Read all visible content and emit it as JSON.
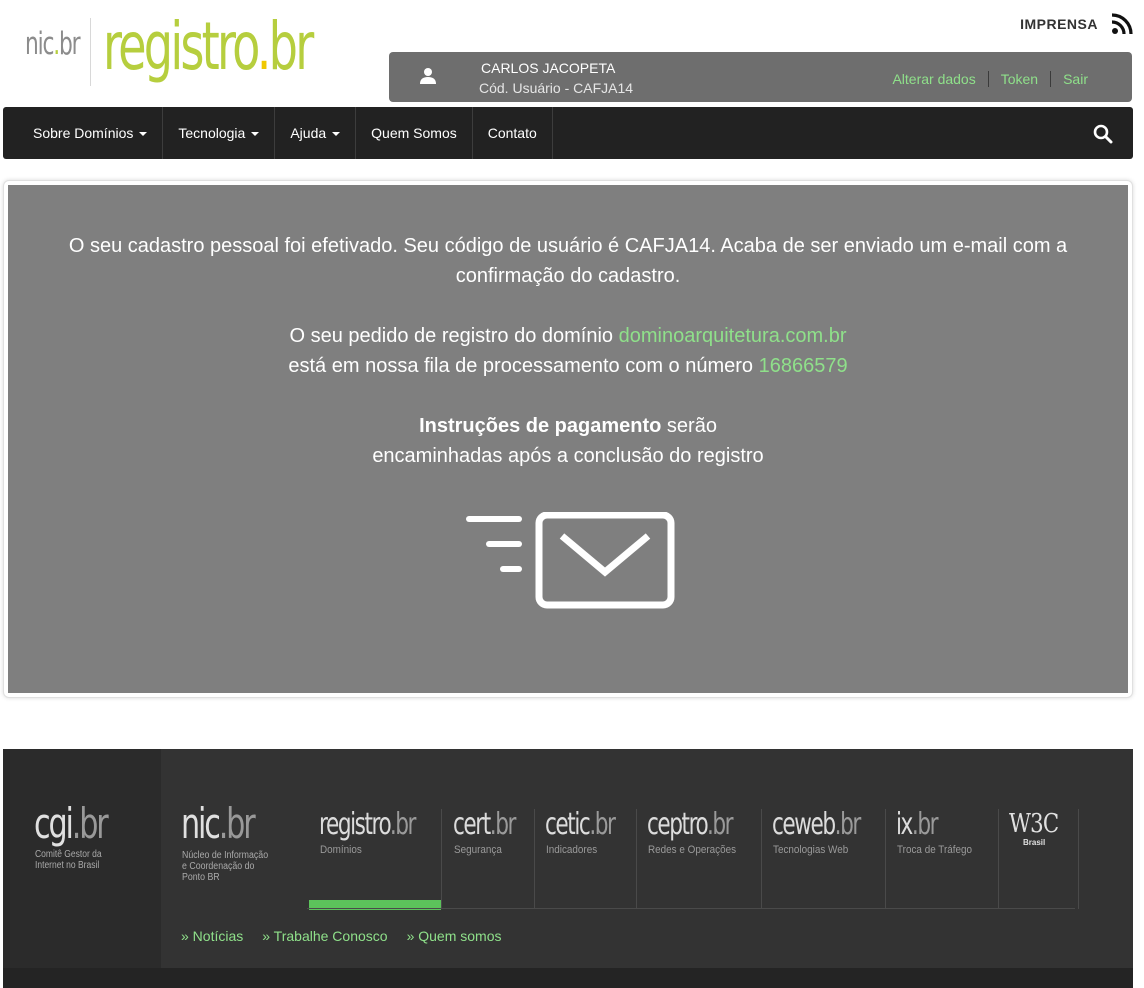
{
  "header": {
    "logo_nic": "nic",
    "logo_nic_tld": "br",
    "logo_registro": "registro",
    "logo_registro_tld": "br",
    "imprensa": "IMPRENSA"
  },
  "user": {
    "name": "CARLOS JACOPETA",
    "code": "Cód. Usuário - CAFJA14",
    "links": [
      "Alterar dados",
      "Token",
      "Sair"
    ]
  },
  "nav": {
    "items": [
      {
        "label": "Sobre Domínios"
      },
      {
        "label": "Tecnologia"
      },
      {
        "label": "Ajuda"
      },
      {
        "label": "Quem Somos"
      },
      {
        "label": "Contato"
      }
    ]
  },
  "main": {
    "line1": "O seu cadastro pessoal foi efetivado. Seu código de usuário é CAFJA14. Acaba de ser enviado um e-mail com a",
    "line2": "confirmação do cadastro.",
    "order_prefix": "O seu pedido de registro do domínio",
    "domain": "dominoarquitetura.com.br",
    "queue_prefix": "está em nossa fila de processamento com o número",
    "queue_number": "16866579",
    "payment_bold": "Instruções de pagamento",
    "payment_rest": "serão",
    "payment_line2": "encaminhadas após a conclusão do registro"
  },
  "footer": {
    "cgi": {
      "name": "cgi",
      "tld": "br",
      "subtitle_lines": [
        "Comitê Gestor da",
        "Internet no Brasil"
      ]
    },
    "nic": {
      "name": "nic",
      "tld": "br",
      "subtitle_lines": [
        "Núcleo de Informação",
        "e Coordenação do",
        "Ponto BR"
      ]
    },
    "orgs": [
      {
        "name": "registro",
        "tld": "br",
        "desc": "Domínios"
      },
      {
        "name": "cert",
        "tld": "br",
        "desc": "Segurança"
      },
      {
        "name": "cetic",
        "tld": "br",
        "desc": "Indicadores"
      },
      {
        "name": "ceptro",
        "tld": "br",
        "desc": "Redes e Operações"
      },
      {
        "name": "ceweb",
        "tld": "br",
        "desc": "Tecnologias Web"
      },
      {
        "name": "ix",
        "tld": "br",
        "desc": "Troca de Tráfego"
      }
    ],
    "w3c": {
      "name": "W3C",
      "sub": "Brasil"
    },
    "links": [
      "» Notícias",
      "» Trabalhe Conosco",
      "» Quem somos"
    ]
  },
  "colors": {
    "accent_green": "#8fe08a",
    "active_bar": "#5cc35b",
    "logo_green": "#b6ce3e",
    "panel_gray": "#7f7f7f",
    "nav_dark": "#222222"
  }
}
